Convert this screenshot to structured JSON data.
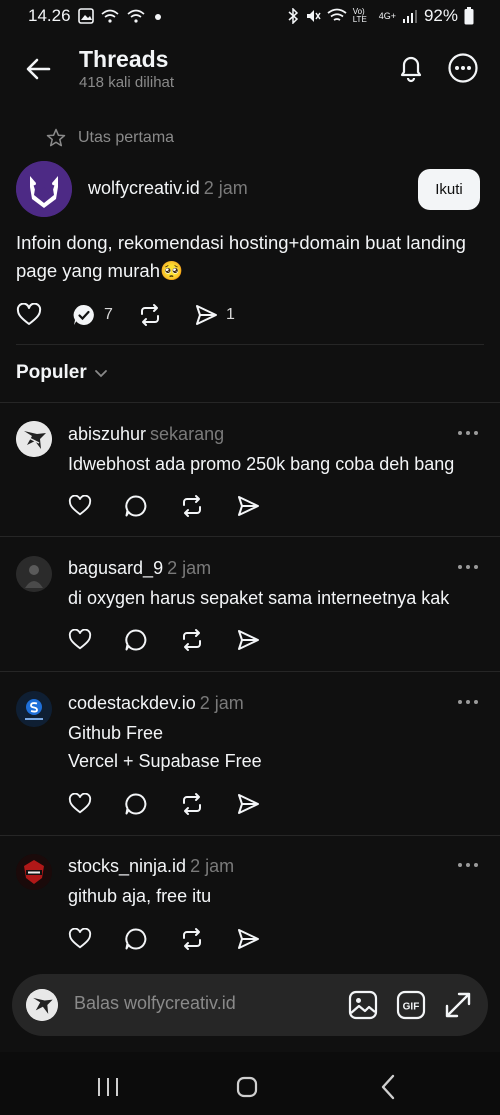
{
  "status_bar": {
    "time": "14.26",
    "battery": "92%",
    "network_label": "4G+",
    "volte_label": "Vo) LTE",
    "icons": [
      "gallery-icon",
      "wifi-call-icon",
      "wifi-call-icon",
      "dot-icon",
      "bluetooth-icon",
      "mute-icon",
      "wifi-icon",
      "signal-icon",
      "battery-icon"
    ]
  },
  "header": {
    "title": "Threads",
    "subtitle": "418 kali dilihat",
    "icons": [
      "back-arrow-icon",
      "bell-icon",
      "more-circle-icon"
    ]
  },
  "post": {
    "thread_label": "Utas pertama",
    "username": "wolfycreativ.id",
    "time": "2 jam",
    "follow_label": "Ikuti",
    "text": "Infoin dong, rekomendasi hosting+domain buat landing page yang murah🥺",
    "reply_count": "7",
    "share_count": "1",
    "accent": "#4d2a85"
  },
  "sort": {
    "label": "Populer"
  },
  "replies": [
    {
      "username": "abiszuhur",
      "time": "sekarang",
      "lines": [
        "Idwebhost ada promo 250k bang coba deh bang"
      ]
    },
    {
      "username": "bagusard_9",
      "time": "2 jam",
      "lines": [
        "di oxygen harus sepaket sama interneetnya kak"
      ]
    },
    {
      "username": "codestackdev.io",
      "time": "2 jam",
      "lines": [
        "Github Free",
        "Vercel + Supabase Free"
      ]
    },
    {
      "username": "stocks_ninja.id",
      "time": "2 jam",
      "lines": [
        "github aja, free itu"
      ]
    }
  ],
  "reply_box": {
    "placeholder": "Balas wolfycreativ.id",
    "gif_label": "GIF"
  },
  "colors": {
    "background": "#101010",
    "text": "#f3f5f7",
    "muted": "#7a7a7a",
    "divider": "#262626"
  }
}
